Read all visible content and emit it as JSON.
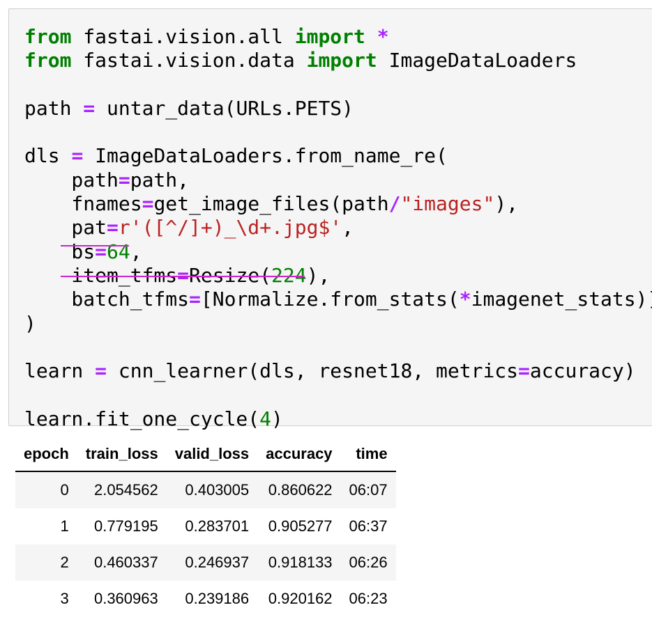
{
  "code_cell": {
    "lines": [
      [
        {
          "t": "from",
          "c": "kw"
        },
        {
          "t": " fastai.vision.all "
        },
        {
          "t": "import",
          "c": "kw"
        },
        {
          "t": " "
        },
        {
          "t": "*",
          "c": "op"
        }
      ],
      [
        {
          "t": "from",
          "c": "kw"
        },
        {
          "t": " fastai.vision.data "
        },
        {
          "t": "import",
          "c": "kw"
        },
        {
          "t": " ImageDataLoaders"
        }
      ],
      [],
      [
        {
          "t": "path "
        },
        {
          "t": "=",
          "c": "op"
        },
        {
          "t": " untar_data(URLs.PETS)"
        }
      ],
      [],
      [
        {
          "t": "dls "
        },
        {
          "t": "=",
          "c": "op"
        },
        {
          "t": " ImageDataLoaders.from_name_re("
        }
      ],
      [
        {
          "t": "    path"
        },
        {
          "t": "=",
          "c": "op"
        },
        {
          "t": "path,"
        }
      ],
      [
        {
          "t": "    fnames"
        },
        {
          "t": "=",
          "c": "op"
        },
        {
          "t": "get_image_files(path"
        },
        {
          "t": "/",
          "c": "op"
        },
        {
          "t": "\"images\"",
          "c": "str"
        },
        {
          "t": "),"
        }
      ],
      [
        {
          "t": "    pat"
        },
        {
          "t": "=",
          "c": "op"
        },
        {
          "t": "r'([^/]+)_\\d+.jpg$'",
          "c": "str"
        },
        {
          "t": ","
        }
      ],
      [
        {
          "t": "    bs"
        },
        {
          "t": "=",
          "c": "op"
        },
        {
          "t": "64",
          "c": "num"
        },
        {
          "t": ","
        }
      ],
      [
        {
          "t": "    item_tfms"
        },
        {
          "t": "=",
          "c": "op"
        },
        {
          "t": "Resize("
        },
        {
          "t": "224",
          "c": "num"
        },
        {
          "t": "),"
        }
      ],
      [
        {
          "t": "    batch_tfms"
        },
        {
          "t": "=",
          "c": "op"
        },
        {
          "t": "[Normalize.from_stats("
        },
        {
          "t": "*",
          "c": "op"
        },
        {
          "t": "imagenet_stats)]"
        }
      ],
      [
        {
          "t": ")"
        }
      ],
      [],
      [
        {
          "t": "learn "
        },
        {
          "t": "=",
          "c": "op"
        },
        {
          "t": " cnn_learner(dls, resnet18, metrics"
        },
        {
          "t": "=",
          "c": "op"
        },
        {
          "t": "accuracy)"
        }
      ],
      [],
      [
        {
          "t": "learn.fit_one_cycle("
        },
        {
          "t": "4",
          "c": "num"
        },
        {
          "t": ")"
        }
      ]
    ],
    "colors": {
      "keyword": "#008000",
      "operator": "#aa22ff",
      "number": "#008000",
      "string": "#ba2121",
      "highlight_underline": "#cc22cc"
    }
  },
  "results_table": {
    "headers": [
      "epoch",
      "train_loss",
      "valid_loss",
      "accuracy",
      "time"
    ],
    "rows": [
      [
        "0",
        "2.054562",
        "0.403005",
        "0.860622",
        "06:07"
      ],
      [
        "1",
        "0.779195",
        "0.283701",
        "0.905277",
        "06:37"
      ],
      [
        "2",
        "0.460337",
        "0.246937",
        "0.918133",
        "06:26"
      ],
      [
        "3",
        "0.360963",
        "0.239186",
        "0.920162",
        "06:23"
      ]
    ]
  }
}
